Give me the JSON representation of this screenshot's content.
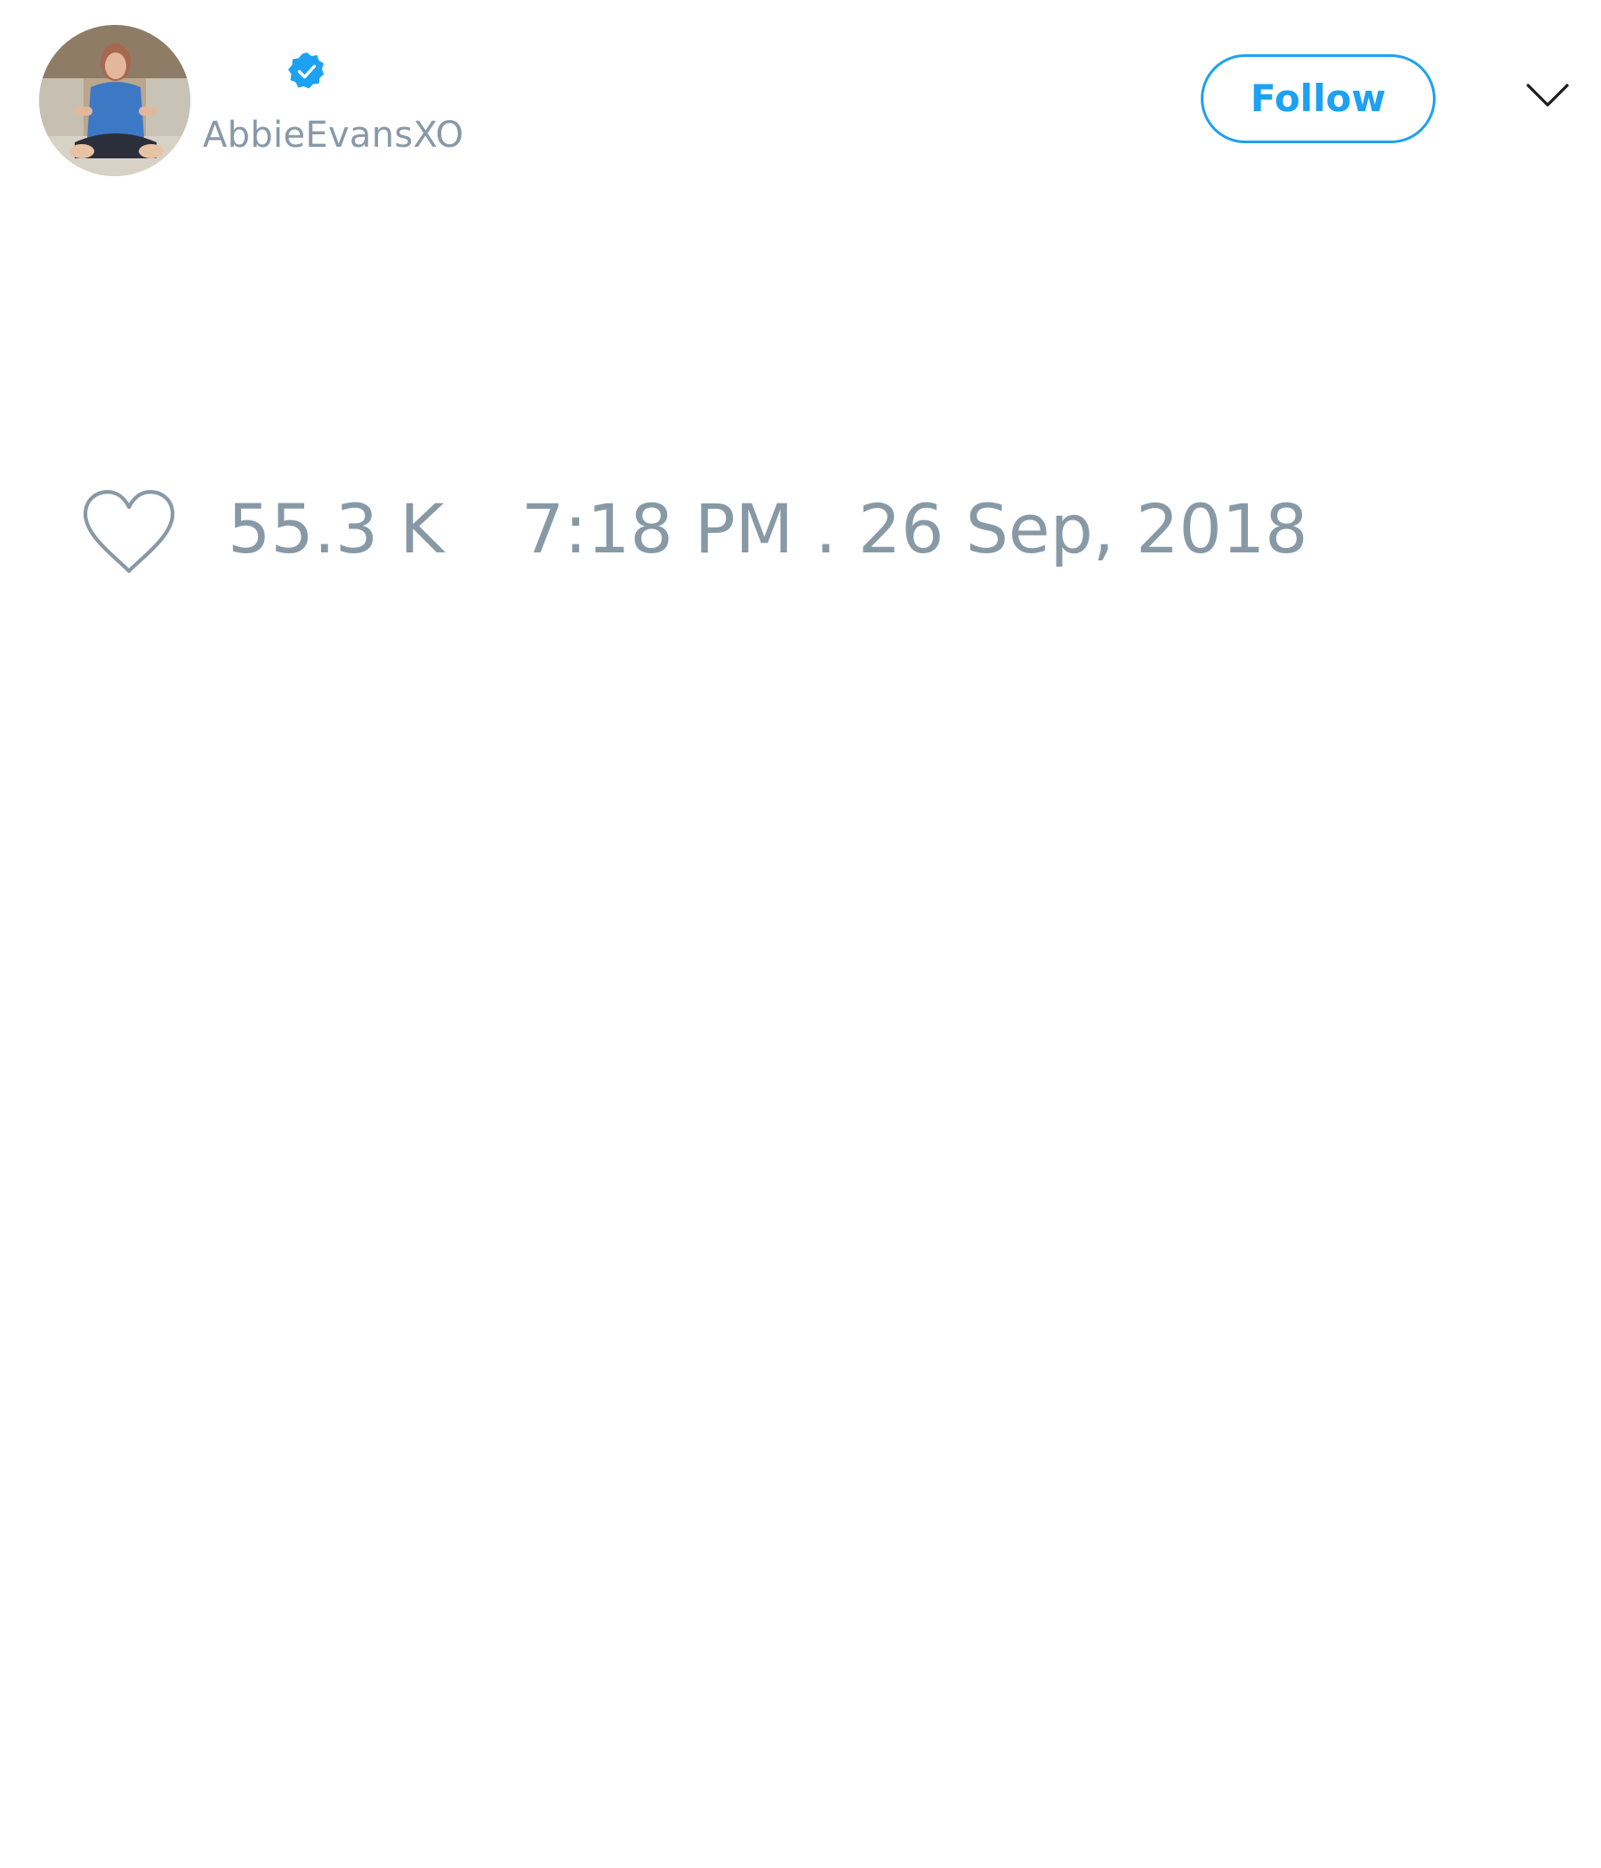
{
  "author": {
    "handle": "AbbieEvansXO",
    "verified": true,
    "avatar": "profile-photo"
  },
  "header": {
    "follow_label": "Follow",
    "menu_icon": "chevron-down-icon"
  },
  "stats": {
    "like_icon": "heart-icon",
    "like_count": "55.3 K",
    "timestamp": "7:18 PM . 26 Sep, 2018"
  },
  "colors": {
    "accent": "#1da1f2",
    "muted_text": "#8899a6",
    "background": "#ffffff"
  }
}
